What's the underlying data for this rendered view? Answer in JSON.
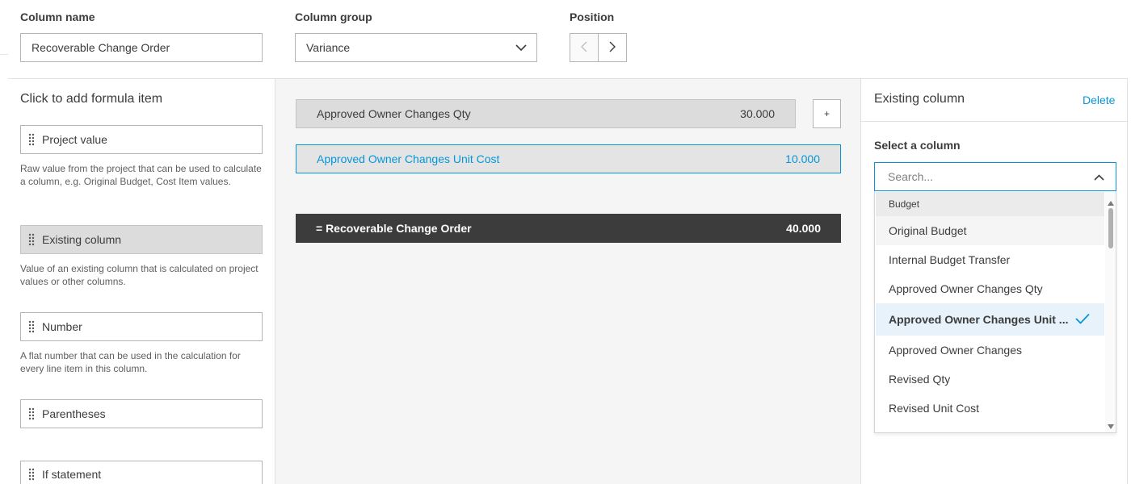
{
  "header": {
    "column_name_label": "Column name",
    "column_name_value": "Recoverable Change Order",
    "column_group_label": "Column group",
    "column_group_value": "Variance",
    "position_label": "Position"
  },
  "left_panel": {
    "title": "Click to add formula item",
    "items": [
      {
        "label": "Project value",
        "description": "Raw value from the project that can be used to calculate a column, e.g. Original Budget, Cost Item values."
      },
      {
        "label": "Existing column",
        "description": "Value of an existing column that is calculated on project values or other columns."
      },
      {
        "label": "Number",
        "description": "A flat number that can be used in the calculation for every line item in this column."
      },
      {
        "label": "Parentheses",
        "description": ""
      },
      {
        "label": "If statement",
        "description": ""
      }
    ]
  },
  "formula": {
    "rows": [
      {
        "label": "Approved Owner Changes Qty",
        "value": "30.000"
      },
      {
        "label": "Approved Owner Changes Unit Cost",
        "value": "10.000"
      }
    ],
    "add_label": "+",
    "result": {
      "label": "= Recoverable Change Order",
      "value": "40.000"
    }
  },
  "right_panel": {
    "title": "Existing column",
    "delete_label": "Delete",
    "select_label": "Select a column",
    "search_placeholder": "Search...",
    "group_header": "Budget",
    "options": [
      "Original Budget",
      "Internal Budget Transfer",
      "Approved Owner Changes Qty",
      "Approved Owner Changes Unit ...",
      "Approved Owner Changes",
      "Revised Qty",
      "Revised Unit Cost"
    ],
    "selected_option": "Approved Owner Changes Unit ..."
  },
  "colors": {
    "accent": "#0696d7",
    "dark_bar": "#3c3c3c",
    "selected_bg": "#dcdcdc",
    "highlight_bg": "#e8f2fa"
  }
}
